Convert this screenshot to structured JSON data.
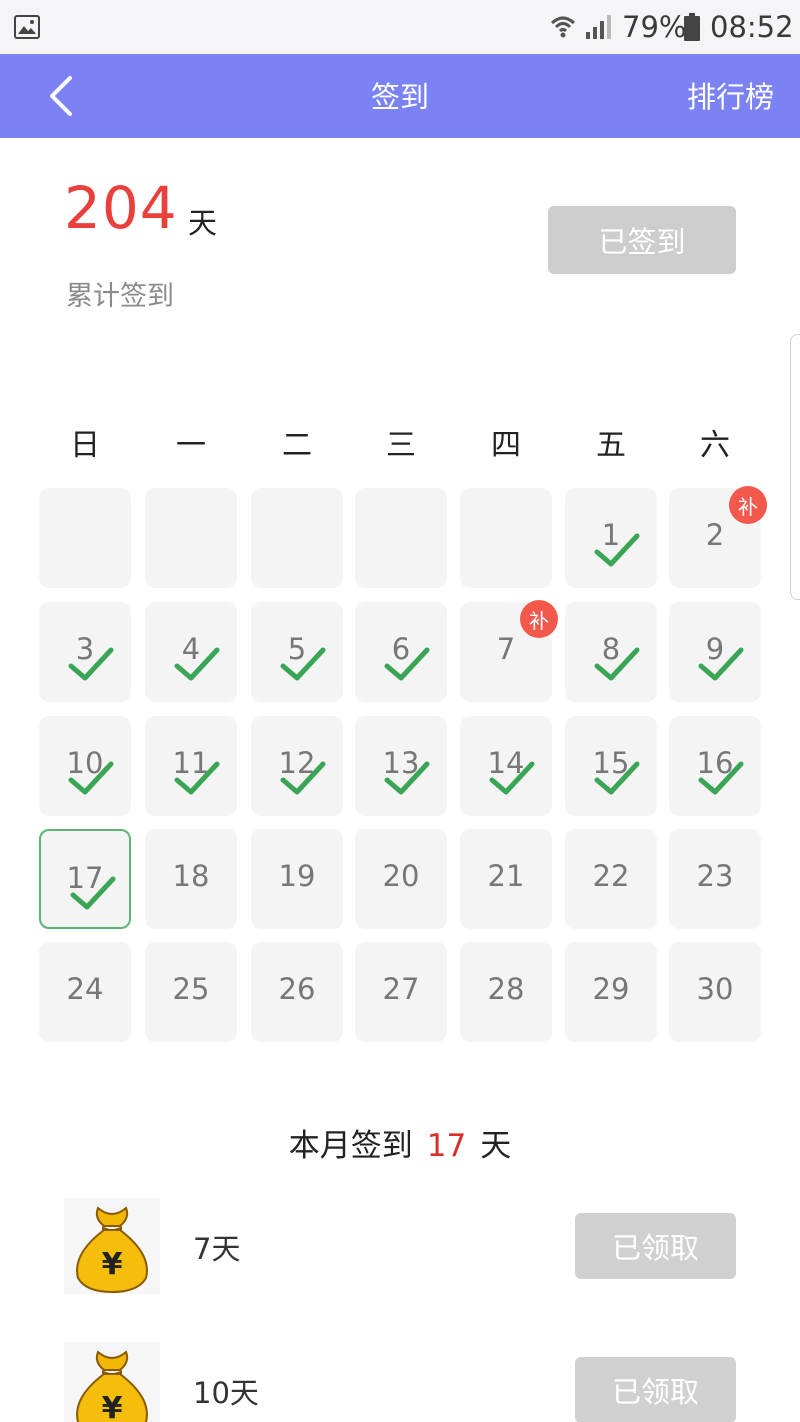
{
  "status_bar": {
    "battery": "79%",
    "time": "08:52"
  },
  "header": {
    "title": "签到",
    "rank_label": "排行榜"
  },
  "summary": {
    "total_days": "204",
    "unit": "天",
    "label": "累计签到",
    "sign_button_label": "已签到"
  },
  "calendar": {
    "weekdays": [
      "日",
      "一",
      "二",
      "三",
      "四",
      "五",
      "六"
    ],
    "days": [
      {
        "day": "1",
        "checked": true
      },
      {
        "day": "2",
        "checked": false,
        "makeup": "补"
      },
      {
        "day": "3",
        "checked": true
      },
      {
        "day": "4",
        "checked": true
      },
      {
        "day": "5",
        "checked": true
      },
      {
        "day": "6",
        "checked": true
      },
      {
        "day": "7",
        "checked": false,
        "makeup": "补"
      },
      {
        "day": "8",
        "checked": true
      },
      {
        "day": "9",
        "checked": true
      },
      {
        "day": "10",
        "checked": true
      },
      {
        "day": "11",
        "checked": true
      },
      {
        "day": "12",
        "checked": true
      },
      {
        "day": "13",
        "checked": true
      },
      {
        "day": "14",
        "checked": true
      },
      {
        "day": "15",
        "checked": true
      },
      {
        "day": "16",
        "checked": true
      },
      {
        "day": "17",
        "checked": true,
        "today": true
      },
      {
        "day": "18",
        "checked": false
      },
      {
        "day": "19",
        "checked": false
      },
      {
        "day": "20",
        "checked": false
      },
      {
        "day": "21",
        "checked": false
      },
      {
        "day": "22",
        "checked": false
      },
      {
        "day": "23",
        "checked": false
      },
      {
        "day": "24",
        "checked": false
      },
      {
        "day": "25",
        "checked": false
      },
      {
        "day": "26",
        "checked": false
      },
      {
        "day": "27",
        "checked": false
      },
      {
        "day": "28",
        "checked": false
      },
      {
        "day": "29",
        "checked": false
      },
      {
        "day": "30",
        "checked": false
      }
    ],
    "leading_blanks": 5
  },
  "monthly": {
    "prefix": "本月签到",
    "count": "17",
    "unit": "天"
  },
  "rewards": [
    {
      "label": "7天",
      "button_label": "已领取",
      "icon": "money-bag-icon"
    },
    {
      "label": "10天",
      "button_label": "已领取",
      "icon": "money-bag-icon"
    }
  ],
  "colors": {
    "header": "#7b82f4",
    "accent_red": "#e8403a",
    "check_green": "#3aa655",
    "badge_red": "#f3584d"
  }
}
